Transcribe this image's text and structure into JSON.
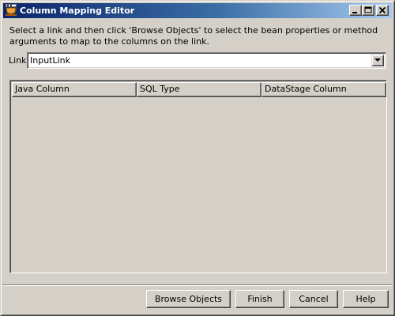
{
  "window": {
    "title": "Column Mapping Editor",
    "icon": "java-cup-icon"
  },
  "instructions": "Select a link and then click 'Browse Objects' to select the bean properties or method arguments to map to the columns on the link.",
  "link": {
    "label": "Link:",
    "selected": "InputLink"
  },
  "grid": {
    "columns": [
      "Java Column",
      "SQL Type",
      "DataStage Column"
    ],
    "rows": []
  },
  "buttons": {
    "browse": "Browse Objects",
    "finish": "Finish",
    "cancel": "Cancel",
    "help": "Help"
  },
  "colors": {
    "title_start": "#0a246a",
    "title_end": "#a6caf0",
    "face": "#d4d0c8"
  }
}
